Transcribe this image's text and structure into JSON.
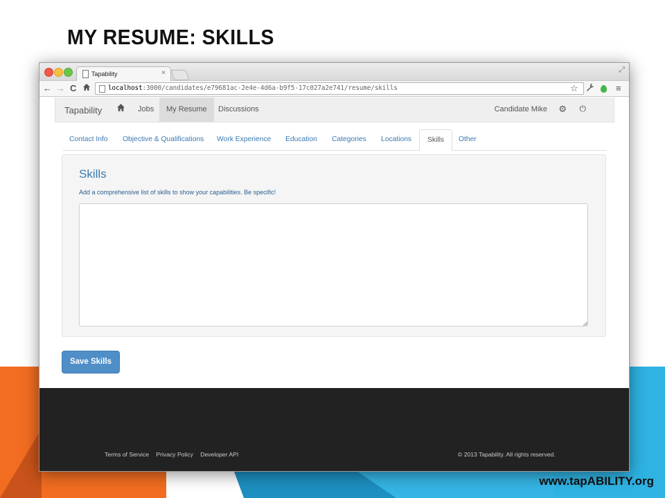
{
  "slide": {
    "title": "MY RESUME: SKILLS",
    "footer_url": "www.tapABILITY.org"
  },
  "browser": {
    "tab_title": "Tapability",
    "tab_close": "×",
    "url_host": "localhost",
    "url_rest": ":3000/candidates/e79681ac-2e4e-4d6a-b9f5-17c027a2e741/resume/skills"
  },
  "icons": {
    "back": "back-arrow-icon",
    "forward": "forward-arrow-icon",
    "reload": "reload-icon",
    "home": "home-icon",
    "star": "star-icon",
    "wrench": "wrench-icon",
    "extension": "extension-icon",
    "menu": "menu-icon",
    "gear": "gear-icon",
    "power": "power-icon"
  },
  "navbar": {
    "brand": "Tapability",
    "links": [
      "Jobs",
      "My Resume",
      "Discussions"
    ],
    "active": "My Resume",
    "user": "Candidate Mike"
  },
  "subtabs": {
    "items": [
      "Contact Info",
      "Objective & Qualifications",
      "Work Experience",
      "Education",
      "Categories",
      "Locations",
      "Skills",
      "Other"
    ],
    "active": "Skills"
  },
  "skills": {
    "heading": "Skills",
    "help": "Add a comprehensive list of skills to show your capabilities. Be specific!",
    "value": "",
    "save_label": "Save Skills"
  },
  "footer": {
    "links": [
      "Terms of Service",
      "Privacy Policy",
      "Developer API"
    ],
    "copyright": "© 2013 Tapability. All rights reserved."
  },
  "colors": {
    "link": "#3a78b0",
    "primary_button": "#4f8ec7",
    "footer_bg": "#222222",
    "accent_orange": "#f26d21",
    "accent_blue": "#2fb3e3"
  }
}
